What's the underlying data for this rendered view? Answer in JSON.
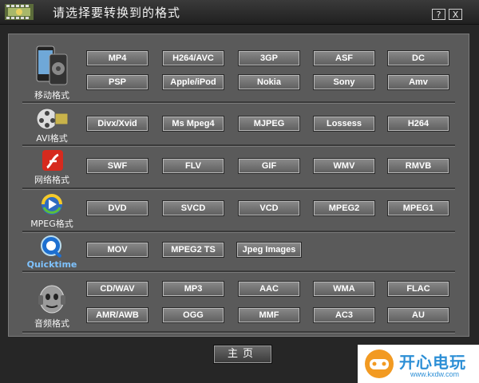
{
  "window": {
    "title": "请选择要转换到的格式",
    "help_label": "?",
    "close_label": "X",
    "home_label": "主页"
  },
  "categories": [
    {
      "label": "移动格式",
      "icon": "mobile-phone-icon",
      "buttons": [
        "MP4",
        "H264/AVC",
        "3GP",
        "ASF",
        "DC",
        "PSP",
        "Apple/iPod",
        "Nokia",
        "Sony",
        "Amv"
      ]
    },
    {
      "label": "AVI格式",
      "icon": "film-reel-icon",
      "buttons": [
        "Divx/Xvid",
        "Ms Mpeg4",
        "MJPEG",
        "Lossess",
        "H264"
      ]
    },
    {
      "label": "网络格式",
      "icon": "flash-icon",
      "buttons": [
        "SWF",
        "FLV",
        "GIF",
        "WMV",
        "RMVB"
      ]
    },
    {
      "label": "MPEG格式",
      "icon": "media-player-icon",
      "buttons": [
        "DVD",
        "SVCD",
        "VCD",
        "MPEG2",
        "MPEG1"
      ]
    },
    {
      "label": "Quicktime",
      "icon": "quicktime-icon",
      "buttons": [
        "MOV",
        "MPEG2 TS",
        "Jpeg Images"
      ]
    },
    {
      "label": "音频格式",
      "icon": "audio-head-icon",
      "buttons": [
        "CD/WAV",
        "MP3",
        "AAC",
        "WMA",
        "FLAC",
        "AMR/AWB",
        "OGG",
        "MMF",
        "AC3",
        "AU"
      ]
    }
  ],
  "watermark": {
    "text": "开心电玩",
    "url": "www.kxdw.com",
    "icon": "game-controller-logo-icon"
  },
  "colors": {
    "panel": "#5a5a5a",
    "background": "#262626",
    "watermark_blue": "#2d8fd6"
  }
}
